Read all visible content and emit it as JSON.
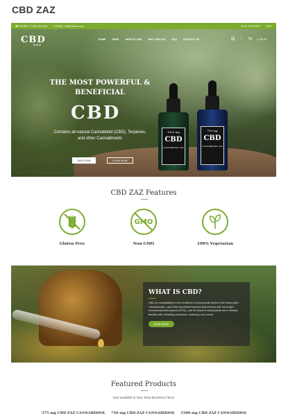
{
  "page": {
    "heading": "CBD ZAZ"
  },
  "topbar": {
    "phone": "☎ PHONE: +1-800-000-0421",
    "email": "✉ EMAIL: info@cbdzaz.com",
    "account": "♟ MY ACCOUNT",
    "cart_link": "CART"
  },
  "nav": {
    "logo": "CBD",
    "logo_sub": "ZAZ",
    "menu": [
      "HOME",
      "SHOP",
      "WHAT IS CBD",
      "WHY CBD ZAZ",
      "FAQ",
      "CONTACT US"
    ],
    "cart_summary": "0 / $0.00"
  },
  "hero": {
    "title": "THE MOST POWERFUL & BENEFICIAL",
    "logo_text": "CBD",
    "subtitle": "Contains all-natural Cannabidiol (CBD), Terpenes, and other Cannabinoids",
    "shop_button": "SHOP NOW",
    "learn_button": "LEARN MORE",
    "bottle1_mg": "1500 mg",
    "bottle2_mg": "750 mg",
    "bottle_brand": "CBD",
    "bottle_tag": "CANNABIDIOL OIL"
  },
  "features": {
    "title": "CBD ZAZ Features",
    "items": [
      {
        "label": "Gluten Free",
        "icon": "wheat-crossed-icon"
      },
      {
        "label": "Non GMO",
        "icon": "gmo-crossed-icon",
        "icon_text": "GMO"
      },
      {
        "label": "100% Vegetarian",
        "icon": "leaf-icon"
      }
    ]
  },
  "cbd": {
    "title": "WHAT IS CBD?",
    "text": "CBD (or cannabidiol) is one of dozens of compounds found in the hemp plant. Cannabinoids—and other beneficial terpenes that interact with our body's endocannabinoid system (ECS)—can be found in many plants we're already familiar with, including echinacea, rosemary, and cocoa.",
    "button": "READ MORE"
  },
  "products": {
    "title": "Featured Products",
    "subtitle": "Now available in New Tasty Blueberry Flavor",
    "items": [
      {
        "name": "375 mg CBD ZAZ CANNABIDIOL"
      },
      {
        "name": "750 mg CBD ZAZ CANNABIDIOL"
      },
      {
        "name": "1500 mg CBD ZAZ CANNABIDIOL"
      }
    ]
  },
  "colors": {
    "accent": "#7cab2e"
  }
}
